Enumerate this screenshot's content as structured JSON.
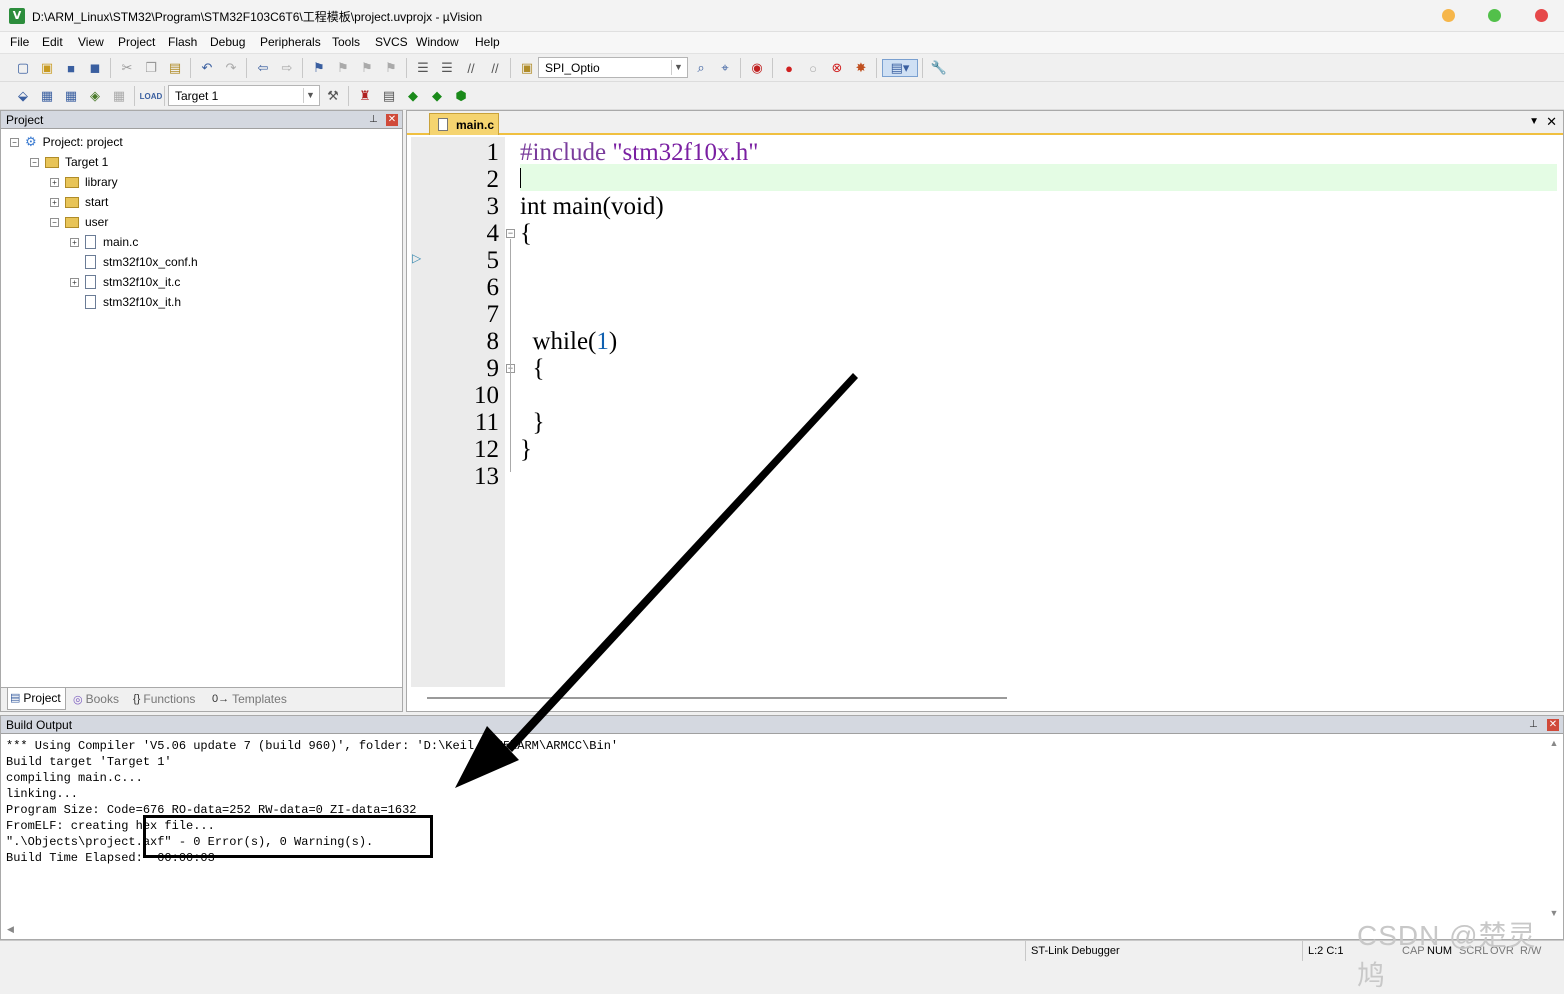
{
  "window": {
    "title": "D:\\ARM_Linux\\STM32\\Program\\STM32F103C6T6\\工程模板\\project.uvprojx - µVision",
    "icon_label": "V"
  },
  "menu": [
    "File",
    "Edit",
    "View",
    "Project",
    "Flash",
    "Debug",
    "Peripherals",
    "Tools",
    "SVCS",
    "Window",
    "Help"
  ],
  "toolbar": {
    "find_combo": "SPI_Optio",
    "target_combo": "Target 1"
  },
  "project_panel": {
    "title": "Project",
    "root": "Project: project",
    "target": "Target 1",
    "groups": [
      "library",
      "start",
      "user"
    ],
    "files": [
      "main.c",
      "stm32f10x_conf.h",
      "stm32f10x_it.c",
      "stm32f10x_it.h"
    ],
    "tabs": [
      "Project",
      "Books",
      "Functions",
      "Templates"
    ],
    "tab_icons": [
      "project-icon",
      "books-icon",
      "functions-icon",
      "templates-icon"
    ]
  },
  "editor": {
    "tab": "main.c",
    "line_numbers": [
      "1",
      "2",
      "3",
      "4",
      "5",
      "6",
      "7",
      "8",
      "9",
      "10",
      "11",
      "12",
      "13"
    ],
    "lines": [
      {
        "a": "#include ",
        "b": "\"stm32f10x.h\""
      },
      {
        "a": "",
        "b": ""
      },
      {
        "a": "int main(void)",
        "b": ""
      },
      {
        "a": "{",
        "b": ""
      },
      {
        "a": "",
        "b": ""
      },
      {
        "a": "",
        "b": ""
      },
      {
        "a": "",
        "b": ""
      },
      {
        "a": "  while(",
        "b": "1",
        "c": ")"
      },
      {
        "a": "  {",
        "b": ""
      },
      {
        "a": "",
        "b": ""
      },
      {
        "a": "  }",
        "b": ""
      },
      {
        "a": "}",
        "b": ""
      },
      {
        "a": "",
        "b": ""
      }
    ],
    "colors": {
      "preprocessor": "#7a3c9c",
      "string": "#7a1fa2",
      "number": "#1060b0"
    }
  },
  "build_output": {
    "title": "Build Output",
    "text": "*** Using Compiler 'V5.06 update 7 (build 960)', folder: 'D:\\Keil MDK5\\ARM\\ARMCC\\Bin'\nBuild target 'Target 1'\ncompiling main.c...\nlinking...\nProgram Size: Code=676 RO-data=252 RW-data=0 ZI-data=1632\nFromELF: creating hex file...\n\".\\Objects\\project.axf\" - 0 Error(s), 0 Warning(s).\nBuild Time Elapsed:  00:00:03"
  },
  "status": {
    "debugger": "ST-Link Debugger",
    "position": "L:2 C:1",
    "indicators": [
      "CAP",
      "NUM",
      "SCRL",
      "OVR",
      "R/W"
    ]
  },
  "watermark": "CSDN @楚灵鸠"
}
